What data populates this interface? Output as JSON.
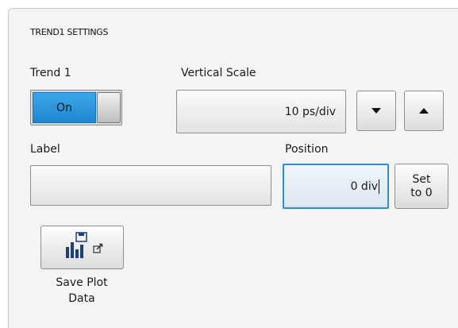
{
  "panel": {
    "title": "TREND1 SETTINGS"
  },
  "trend": {
    "label": "Trend 1",
    "toggle_value": "On"
  },
  "vertical_scale": {
    "label": "Vertical Scale",
    "value": "10 ps/div"
  },
  "label_section": {
    "label": "Label",
    "value": ""
  },
  "position": {
    "label": "Position",
    "value": "0 div"
  },
  "set_to_zero": {
    "line1": "Set",
    "line2": "to 0"
  },
  "save_plot": {
    "line1": "Save Plot",
    "line2": "Data"
  },
  "colors": {
    "toggle_on": "#1f86d0",
    "focus_border": "#2b8de0",
    "chart_icon": "#1e3f7a"
  },
  "icons": [
    "chevron-down-icon",
    "chevron-up-icon",
    "save-plot-icon",
    "external-link-icon"
  ]
}
